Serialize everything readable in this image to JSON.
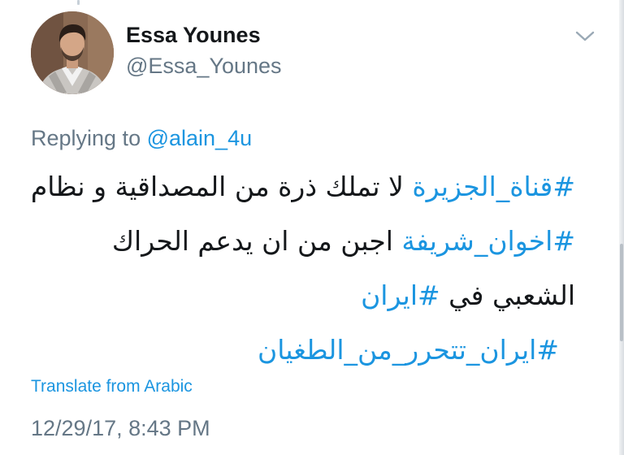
{
  "tweet": {
    "author": {
      "display_name": "Essa Younes",
      "handle": "@Essa_Younes",
      "avatar_icon": "profile-photo"
    },
    "menu_icon": "chevron-down-icon",
    "replying": {
      "prefix": "Replying to ",
      "mention": "@alain_4u"
    },
    "lines": [
      {
        "hashtag": "#قناة_الجزيرة",
        "text": " لا تملك ذرة من المصداقية و نظام"
      },
      {
        "hashtag": "#اخوان_شريفة",
        "text": " اجبن من ان يدعم الحراك"
      },
      {
        "text": "الشعبي في ",
        "hashtag": "#ايران"
      },
      {
        "hashtag": "#ايران_تتحرر_من_الطغيان"
      }
    ],
    "translate_label": "Translate from Arabic",
    "timestamp": "12/29/17, 8:43 PM"
  },
  "colors": {
    "link": "#1b95e0",
    "secondary": "#657786",
    "primary_text": "#14171a"
  }
}
